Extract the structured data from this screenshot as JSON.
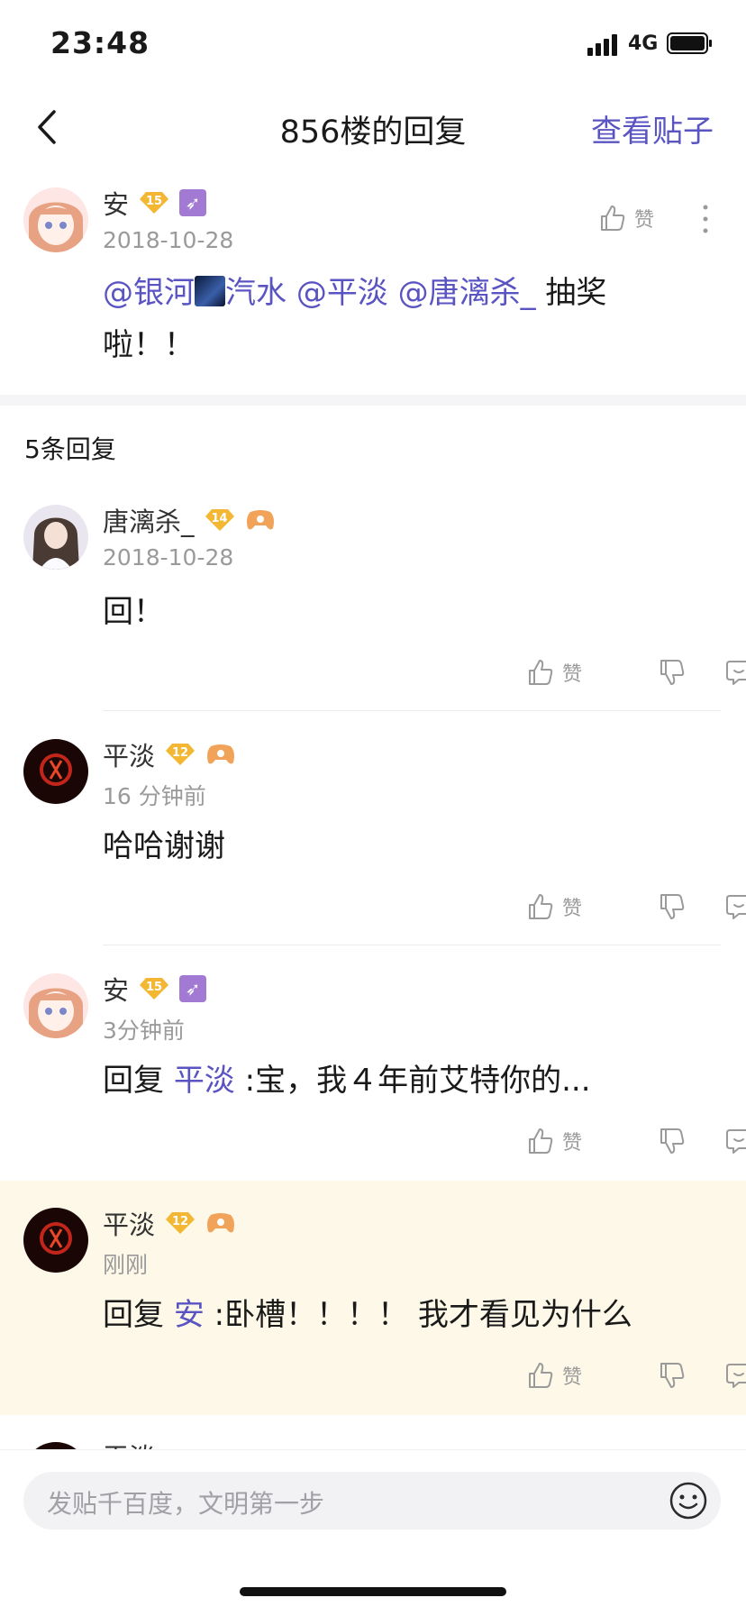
{
  "status": {
    "time": "23:48",
    "network": "4G"
  },
  "nav": {
    "title": "856楼的回复",
    "action": "查看贴子"
  },
  "main_post": {
    "user": "安",
    "level": "15",
    "date": "2018-10-28",
    "like_label": "赞",
    "mention1": "@银河",
    "mention1b": "汽水",
    "mention2": "@平淡",
    "mention3": "@唐漓杀_",
    "text_after": " 抽奖",
    "text_line2": "啦！！"
  },
  "reply_count": "5条回复",
  "replies": [
    {
      "user": "唐漓杀_",
      "level": "14",
      "time": "2018-10-28",
      "prefix": "",
      "target": "",
      "text": "回！",
      "like_label": "赞"
    },
    {
      "user": "平淡",
      "level": "12",
      "time": "16 分钟前",
      "prefix": "",
      "target": "",
      "text": "哈哈谢谢",
      "like_label": "赞"
    },
    {
      "user": "安",
      "level": "15",
      "time": "3分钟前",
      "prefix": "回复 ",
      "target": "平淡",
      "text": " :宝，我４年前艾特你的...",
      "like_label": "赞"
    },
    {
      "user": "平淡",
      "level": "12",
      "time": "刚刚",
      "prefix": "回复 ",
      "target": "安",
      "text": " :卧槽！！！！ 我才看见为什么",
      "like_label": "赞"
    }
  ],
  "partial_next": {
    "user": "平淡"
  },
  "input": {
    "placeholder": "发贴千百度，文明第一步"
  },
  "icons": {
    "back": "chevron-left-icon",
    "like": "thumbs-up-icon",
    "dislike": "thumbs-down-icon",
    "comment": "comment-icon",
    "more": "more-vertical-icon",
    "emoji": "smiley-icon"
  },
  "colors": {
    "accent": "#5a54c2",
    "highlight": "#fdf8e7",
    "badge": "#f3b733"
  }
}
